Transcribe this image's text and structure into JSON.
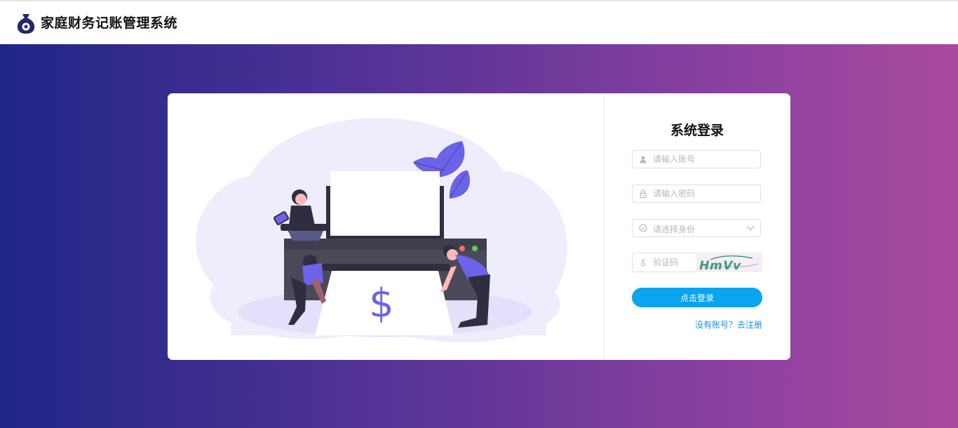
{
  "header": {
    "app_title": "家庭财务记账管理系统",
    "logo_icon": "money-bag-icon"
  },
  "colors": {
    "gradient_start": "#1f2687",
    "gradient_end": "#a94a9e",
    "accent": "#0aa4f0",
    "link": "#1890d8"
  },
  "illustration": {
    "dollar_sign": "$"
  },
  "login_form": {
    "title": "系统登录",
    "account_placeholder": "请输入账号",
    "password_placeholder": "请输入密码",
    "role_select_value": "请选择身份",
    "captcha_placeholder": "验证码",
    "captcha_text": "HmVv",
    "submit_label": "点击登录",
    "register_link": "没有账号？去注册"
  }
}
